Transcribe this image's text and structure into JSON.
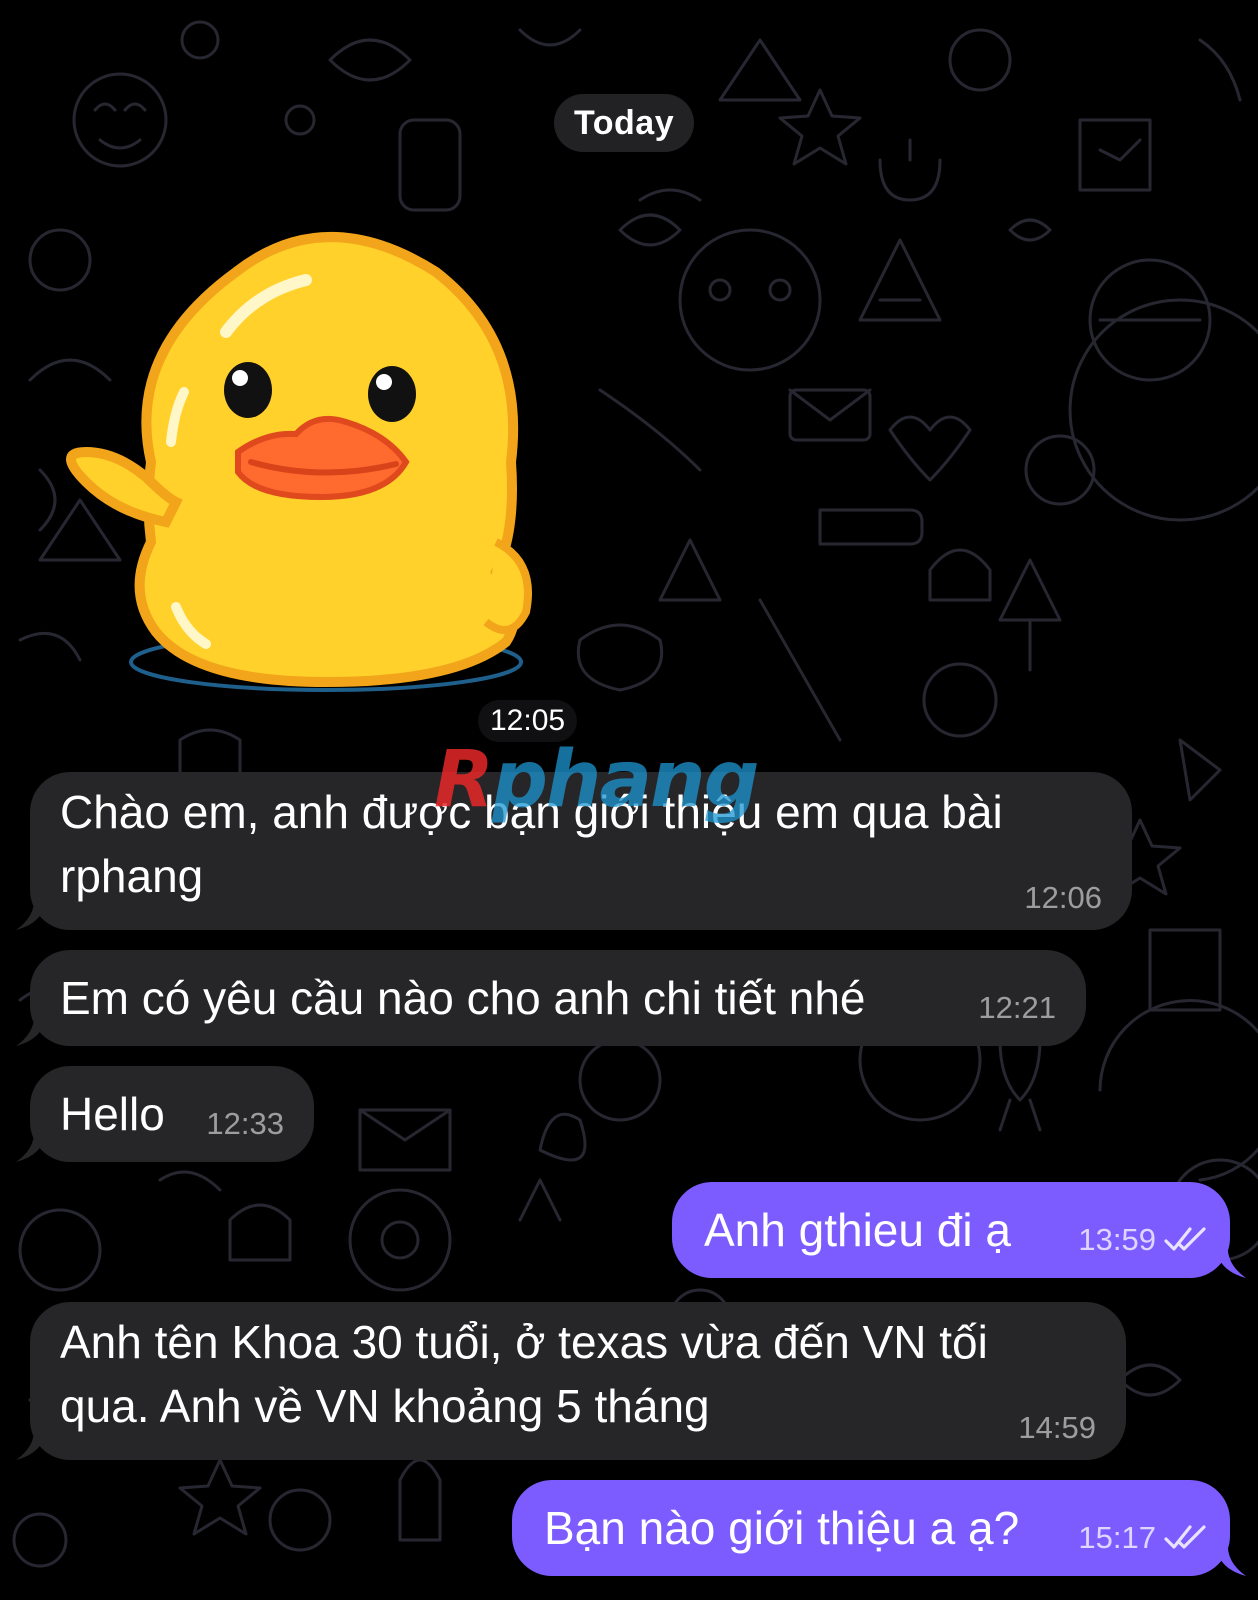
{
  "chat": {
    "date_separator": "Today",
    "sticker": {
      "name": "duck-waving-sticker",
      "time": "12:05"
    },
    "messages": [
      {
        "direction": "in",
        "text_lines": [
          "Chào em, anh được bạn giới thiệu em qua bài",
          "rphang"
        ],
        "time": "12:06"
      },
      {
        "direction": "in",
        "text": "Em có yêu cầu nào cho anh chi tiết nhé",
        "time": "12:21"
      },
      {
        "direction": "in",
        "text": "Hello",
        "time": "12:33"
      },
      {
        "direction": "out",
        "text": "Anh gthieu đi ạ",
        "time": "13:59",
        "status": "read"
      },
      {
        "direction": "in",
        "text_lines": [
          "Anh tên Khoa 30 tuổi, ở texas vừa đến VN tối",
          "qua. Anh về VN khoảng 5 tháng"
        ],
        "time": "14:59"
      },
      {
        "direction": "out",
        "text": "Bạn nào giới thiệu a ạ?",
        "time": "15:17",
        "status": "read"
      }
    ]
  },
  "watermark": {
    "first_letter": "R",
    "rest": "phang"
  },
  "colors": {
    "background": "#000000",
    "incoming_bubble": "#262628",
    "outgoing_bubble": "#7c5cff",
    "doodle_stroke": "#2a2a34"
  }
}
